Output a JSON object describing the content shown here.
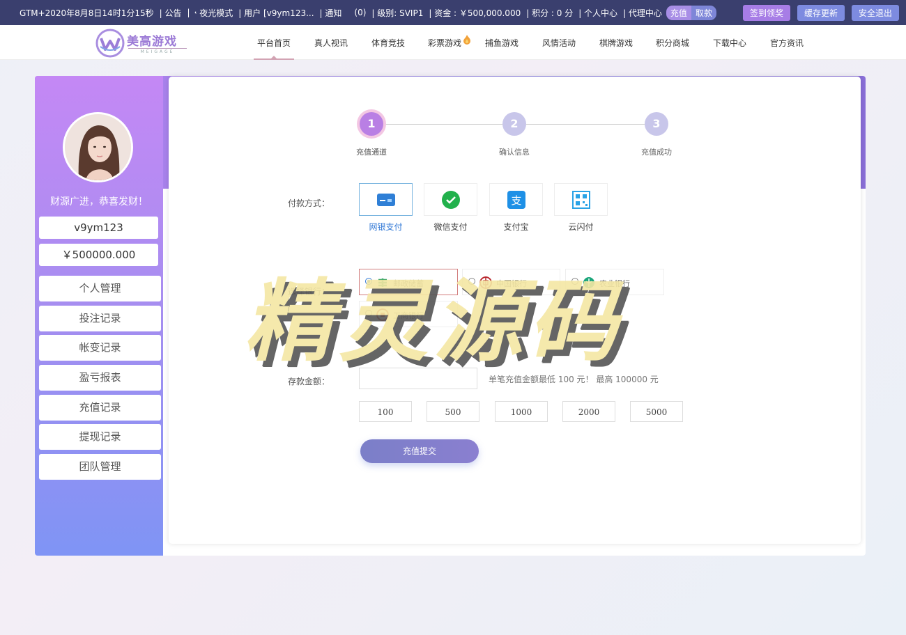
{
  "topbar": {
    "time": "GTM+2020年8月8日14时1分15秒",
    "notice": "| 公告",
    "night_mode": "夜光模式",
    "user": "| 用户 [v9ym123...",
    "notify": "| 通知",
    "notify_count": "(0)",
    "level": "| 级别: SVIP1",
    "funds": "| 资金 : ￥500,000.000",
    "points": "| 积分 : 0 分",
    "personal_center": "| 个人中心",
    "agent_center": "| 代理中心",
    "recharge": "充值",
    "withdraw": "取款",
    "checkin": "签到领奖",
    "cache_update": "缓存更新",
    "logout": "安全退出"
  },
  "nav": {
    "logo_text": "美高游戏",
    "logo_sub": "MEIGAGE",
    "items": [
      "平台首页",
      "真人视讯",
      "体育竞技",
      "彩票游戏",
      "捕鱼游戏",
      "风情活动",
      "棋牌游戏",
      "积分商城",
      "下载中心",
      "官方资讯"
    ]
  },
  "sidebar": {
    "slogan": "财源广进，恭喜发财！",
    "username": "v9ym123",
    "balance": "￥500000.000",
    "menu": [
      "个人管理",
      "投注记录",
      "帐变记录",
      "盈亏报表",
      "充值记录",
      "提现记录",
      "团队管理"
    ]
  },
  "steps": [
    {
      "num": "1",
      "label": "充值通道"
    },
    {
      "num": "2",
      "label": "确认信息"
    },
    {
      "num": "3",
      "label": "充值成功"
    }
  ],
  "form": {
    "payment_label": "付款方式：",
    "payment_methods": [
      "网银支付",
      "微信支付",
      "支付宝",
      "云闪付"
    ],
    "bank_label": "选择银行：",
    "banks": [
      "邮政储蓄",
      "中国银行",
      "农业银行",
      "工商银行"
    ],
    "amount_label": "存款金额：",
    "amount_tip": "单笔充值金额最低 100 元！ 最高 100000 元",
    "quick_amounts": [
      "100",
      "500",
      "1000",
      "2000",
      "5000"
    ],
    "submit": "充值提交"
  },
  "watermark": "精灵源码",
  "colors": {
    "topbar": "#3a3f6e",
    "accent_purple": "#a97de8",
    "step_active": "#b97fe4",
    "step_inactive": "#c8c6ea"
  }
}
